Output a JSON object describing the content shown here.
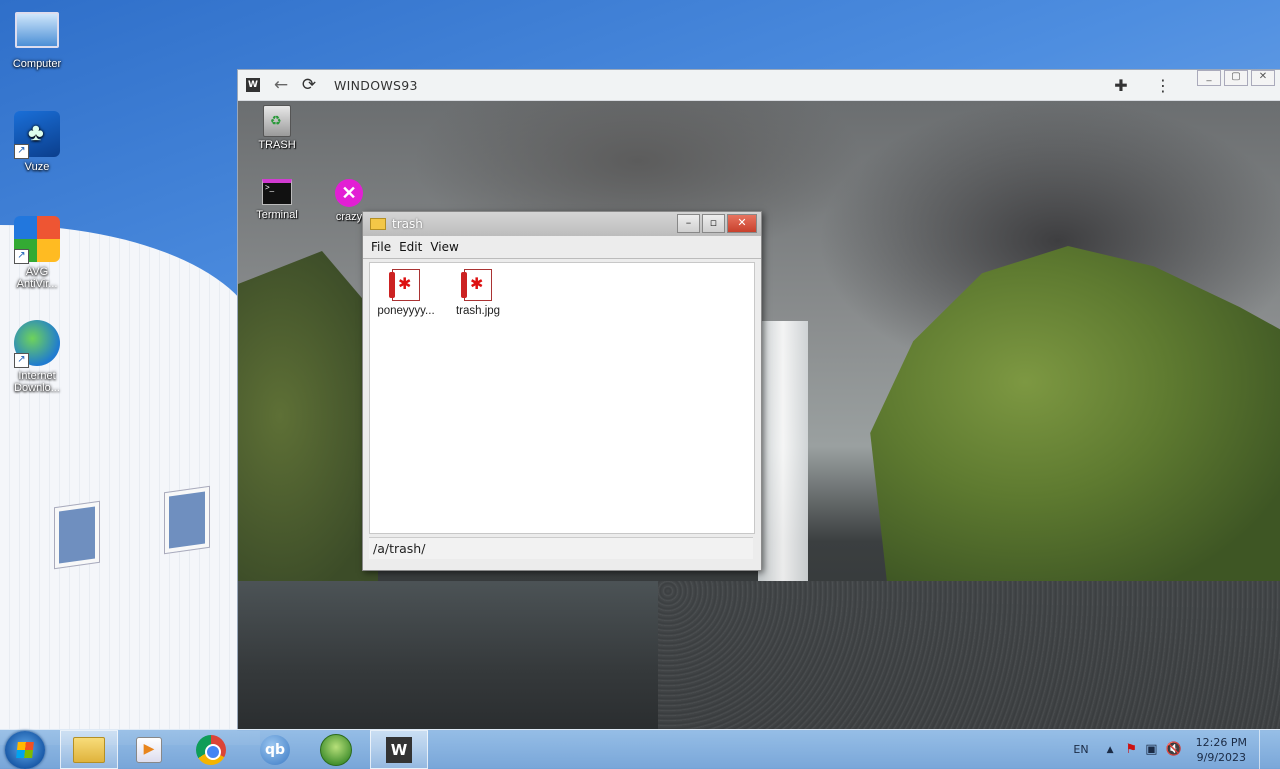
{
  "desktop": {
    "icons": [
      {
        "label": "Computer"
      },
      {
        "label": "Vuze"
      },
      {
        "label": "AVG AntiVir..."
      },
      {
        "label": "Internet Downlo..."
      }
    ]
  },
  "browser": {
    "favicon": "W",
    "title": "WINDOWS93",
    "back_icon": "←",
    "reload_icon": "⟳",
    "extensions_icon": "✚",
    "menu_icon": "⋮"
  },
  "w93": {
    "icons": [
      {
        "label": "TRASH"
      },
      {
        "label": "Terminal"
      },
      {
        "label": "crazy"
      }
    ]
  },
  "explorer": {
    "title": "trash",
    "menu": [
      "File",
      "Edit",
      "View"
    ],
    "files": [
      {
        "name": "poneyyyy..."
      },
      {
        "name": "trash.jpg"
      }
    ],
    "path": "/a/trash/"
  },
  "taskbar": {
    "lang": "EN",
    "time": "12:26 PM",
    "date": "9/9/2023",
    "apps": [
      "File Explorer",
      "Media Player",
      "Chrome",
      "qBittorrent",
      "Windows",
      "Windows93"
    ]
  },
  "colors": {
    "taskbar": "#8cb3dd",
    "close_button": "#c7402c",
    "crazy_icon": "#e21fd4"
  }
}
